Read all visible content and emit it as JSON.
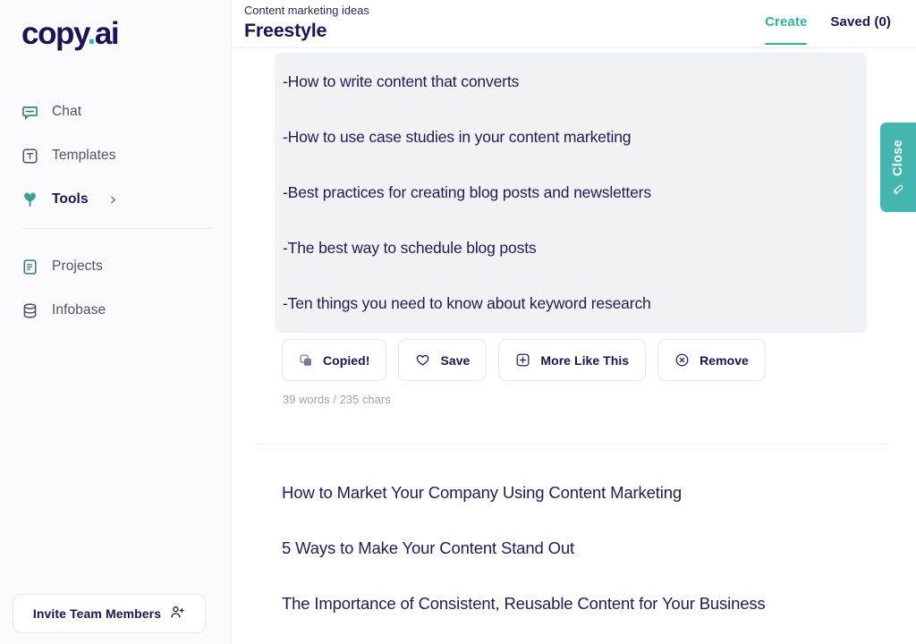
{
  "brand": {
    "logo_part1": "copy",
    "logo_dot": ".",
    "logo_part2": "ai",
    "accent_teal": "#2fb49b",
    "navy": "#1e1352"
  },
  "sidebar": {
    "primary_items": [
      {
        "label": "Chat",
        "icon": "chat-bubble-icon",
        "active": false
      },
      {
        "label": "Templates",
        "icon": "template-icon",
        "active": false
      },
      {
        "label": "Tools",
        "icon": "tools-icon",
        "active": true,
        "chevron": "›"
      }
    ],
    "secondary_items": [
      {
        "label": "Projects",
        "icon": "document-icon"
      },
      {
        "label": "Infobase",
        "icon": "database-icon"
      }
    ],
    "invite_label": "Invite Team Members",
    "invite_icon": "user-plus-icon"
  },
  "header": {
    "breadcrumb": "Content marketing ideas",
    "title": "Freestyle",
    "tabs": [
      {
        "label": "Create",
        "active": true
      },
      {
        "label": "Saved (0)",
        "active": false
      }
    ]
  },
  "result": {
    "lines": [
      "-How to write content that converts",
      "-How to use case studies in your content marketing",
      "-Best practices for creating blog posts and newsletters",
      "-The best way to schedule blog posts",
      "-Ten things you need to know about keyword research"
    ],
    "actions": [
      {
        "label": "Copied!",
        "icon": "copy-icon"
      },
      {
        "label": "Save",
        "icon": "heart-icon"
      },
      {
        "label": "More Like This",
        "icon": "plus-square-icon"
      },
      {
        "label": "Remove",
        "icon": "x-circle-icon"
      }
    ],
    "word_count": "39 words / 235 chars"
  },
  "suggestions": [
    "How to Market Your Company Using Content Marketing",
    "5 Ways to Make Your Content Stand Out",
    "The Importance of Consistent, Reusable Content for Your Business"
  ],
  "close_panel": {
    "label": "Close",
    "icon": "pen-icon"
  }
}
